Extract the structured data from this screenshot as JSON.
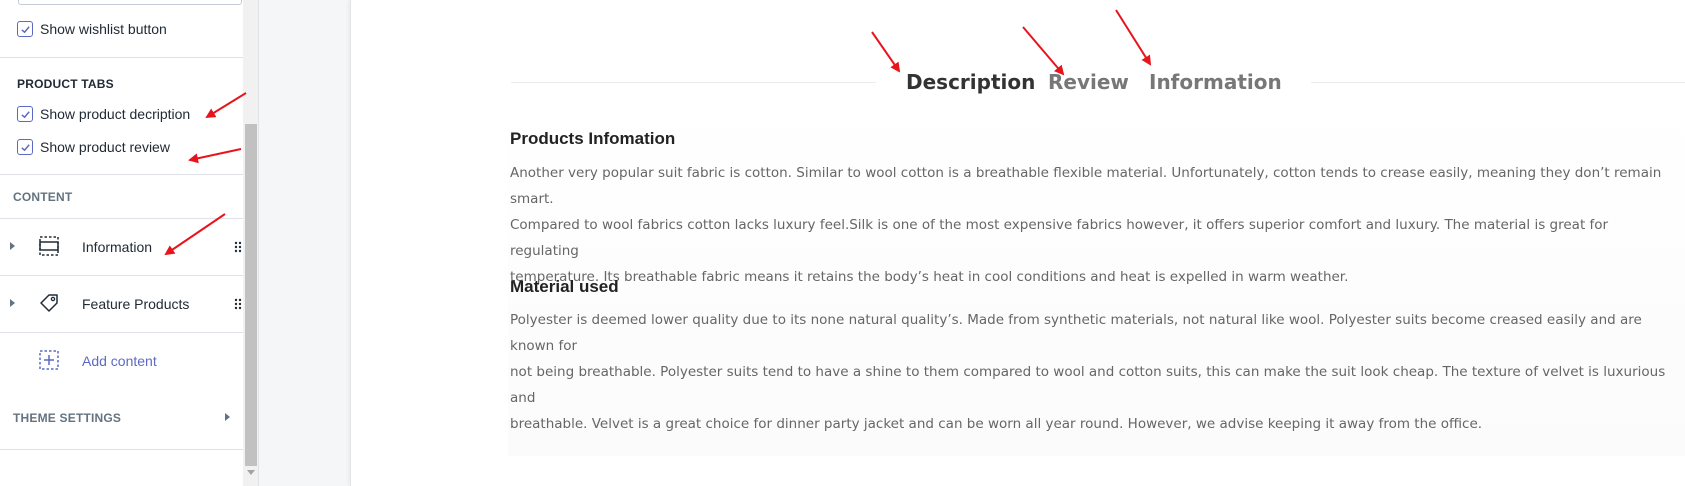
{
  "sidebar": {
    "wishlist_label": "Show wishlist button",
    "product_tabs_heading": "PRODUCT TABS",
    "show_description_label": "Show product decription",
    "show_review_label": "Show product review",
    "content_heading": "CONTENT",
    "items": [
      {
        "label": "Information",
        "icon": "section-icon"
      },
      {
        "label": "Feature Products",
        "icon": "tag-icon"
      }
    ],
    "add_content_label": "Add content",
    "theme_settings_label": "THEME SETTINGS"
  },
  "preview": {
    "tabs": [
      "Description",
      "Review",
      "Information"
    ],
    "active_tab": "Description",
    "sections": [
      {
        "heading": "Products Infomation",
        "lines": [
          "Another very popular suit fabric is cotton. Similar to wool cotton is a breathable flexible material. Unfortunately, cotton tends to crease easily, meaning they don’t remain smart.",
          "Compared to wool fabrics cotton lacks luxury feel.Silk is one of the most expensive fabrics however, it offers superior comfort and luxury. The material is great for regulating",
          "temperature. Its breathable fabric means it retains the body’s heat in cool conditions and heat is expelled in warm weather."
        ]
      },
      {
        "heading": "Material used",
        "lines": [
          "Polyester is deemed lower quality due to its none natural quality’s. Made from synthetic materials, not natural like wool. Polyester suits become creased easily and are known for",
          "not being breathable. Polyester suits tend to have a shine to them compared to wool and cotton suits, this can make the suit look cheap. The texture of velvet is luxurious and",
          "breathable. Velvet is a great choice for dinner party jacket and can be worn all year round. However, we advise keeping it away from the office."
        ]
      }
    ]
  },
  "colors": {
    "accent": "#5c6ac4",
    "annotation_arrow": "#e8141b",
    "text_dark": "#212b36",
    "text_muted": "#637381"
  }
}
